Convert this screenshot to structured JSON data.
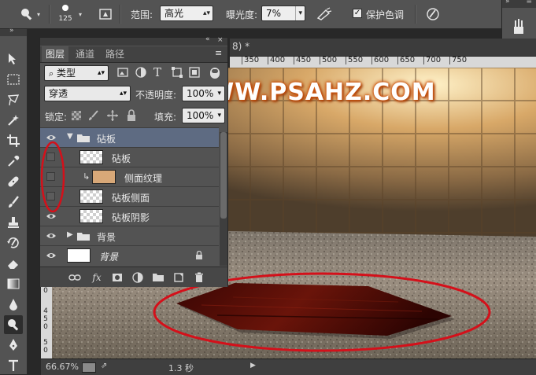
{
  "options_bar": {
    "brush_size": "125",
    "range_label": "范围:",
    "range_value": "高光",
    "exposure_label": "曝光度:",
    "exposure_value": "7%",
    "protect_tones_label": "保护色调",
    "protect_tones_checked": true
  },
  "document": {
    "tab_title": "8) *",
    "ruler_h": [
      "350",
      "400",
      "450",
      "500",
      "550",
      "600",
      "650",
      "700",
      "750"
    ],
    "ruler_v": [
      "0",
      "4",
      "5",
      "0",
      "5",
      "0"
    ],
    "watermark": "WWW.PSAHZ.COM"
  },
  "layers_panel": {
    "tabs": [
      "图层",
      "通道",
      "路径"
    ],
    "filter_value": "类型",
    "blend_mode": "穿透",
    "opacity_label": "不透明度:",
    "opacity_value": "100%",
    "lock_label": "锁定:",
    "fill_label": "填充:",
    "fill_value": "100%",
    "layers": [
      {
        "name": "砧板",
        "type": "group",
        "visible": true
      },
      {
        "name": "砧板",
        "type": "layer",
        "visible": false
      },
      {
        "name": "侧面纹理",
        "type": "clipped",
        "visible": false
      },
      {
        "name": "砧板侧面",
        "type": "layer",
        "visible": false
      },
      {
        "name": "砧板阴影",
        "type": "layer",
        "visible": true
      },
      {
        "name": "背景",
        "type": "group",
        "visible": true
      },
      {
        "name": "背景",
        "type": "background",
        "visible": true
      }
    ]
  },
  "status_bar": {
    "zoom": "66.67%",
    "timing": "1.3 秒"
  },
  "colors": {
    "panel_bg": "#535353",
    "selected_group": "#5e6b82",
    "annotation_red": "#d4101a",
    "watermark_glow": "#d05a12"
  }
}
